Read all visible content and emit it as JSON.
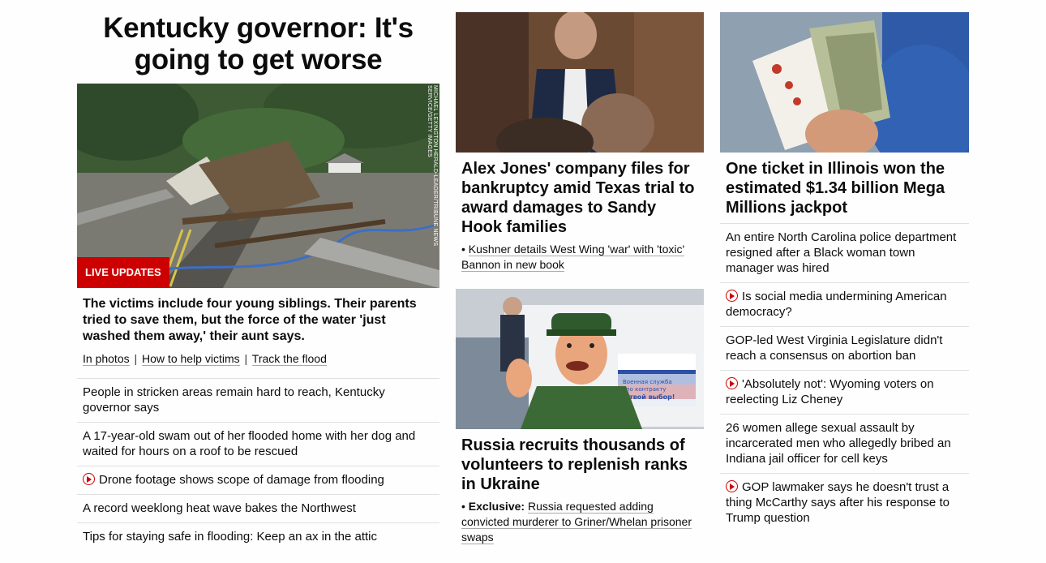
{
  "lead": {
    "title": "Kentucky governor: It's going to get worse",
    "badge": "LIVE UPDATES",
    "credit": "MICHAEL LEXINGTON HERALD-LEADER/TRIBUNE NEWS SERVICE/GETTY IMAGES",
    "description": "The victims include four young siblings. Their parents tried to save them, but the force of the water 'just washed them away,' their aunt says.",
    "links": [
      "In photos",
      "How to help victims",
      "Track the flood"
    ],
    "link_sep": "|",
    "list": [
      {
        "text": "People in stricken areas remain hard to reach, Kentucky governor says",
        "video": false
      },
      {
        "text": "A 17-year-old swam out of her flooded home with her dog and waited for hours on a roof to be rescued",
        "video": false
      },
      {
        "text": "Drone footage shows scope of damage from flooding",
        "video": true
      },
      {
        "text": "A record weeklong heat wave bakes the Northwest",
        "video": false
      },
      {
        "text": "Tips for staying safe in flooding: Keep an ax in the attic",
        "video": false
      }
    ]
  },
  "middle": {
    "card1": {
      "title": "Alex Jones' company files for bankruptcy amid Texas trial to award damages to Sandy Hook families",
      "sub_bullet": "•",
      "sub": "Kushner details West Wing 'war' with 'toxic' Bannon in new book"
    },
    "card2": {
      "title": "Russia recruits thousands of volunteers to replenish ranks in Ukraine",
      "sub_bullet": "•",
      "sub_bold": "Exclusive:",
      "sub": "Russia requested adding convicted murderer to Griner/Whelan prisoner swaps",
      "sign_text_1": "Военная служба",
      "sign_text_2": "по контракту",
      "sign_text_3": "- твой выбор!"
    }
  },
  "right": {
    "card": {
      "title": "One ticket in Illinois won the estimated $1.34 billion Mega Millions jackpot"
    },
    "list": [
      {
        "text": "An entire North Carolina police department resigned after a Black woman town manager was hired",
        "video": false
      },
      {
        "text": "Is social media undermining American democracy?",
        "video": true
      },
      {
        "text": "GOP-led West Virginia Legislature didn't reach a consensus on abortion ban",
        "video": false
      },
      {
        "text": "'Absolutely not': Wyoming voters on reelecting Liz Cheney",
        "video": true
      },
      {
        "text": "26 women allege sexual assault by incarcerated men who allegedly bribed an Indiana jail officer for cell keys",
        "video": false
      },
      {
        "text": "GOP lawmaker says he doesn't trust a thing McCarthy says after his response to Trump question",
        "video": true
      }
    ]
  },
  "colors": {
    "accent": "#cc0000",
    "divider": "#e0e0e0"
  }
}
